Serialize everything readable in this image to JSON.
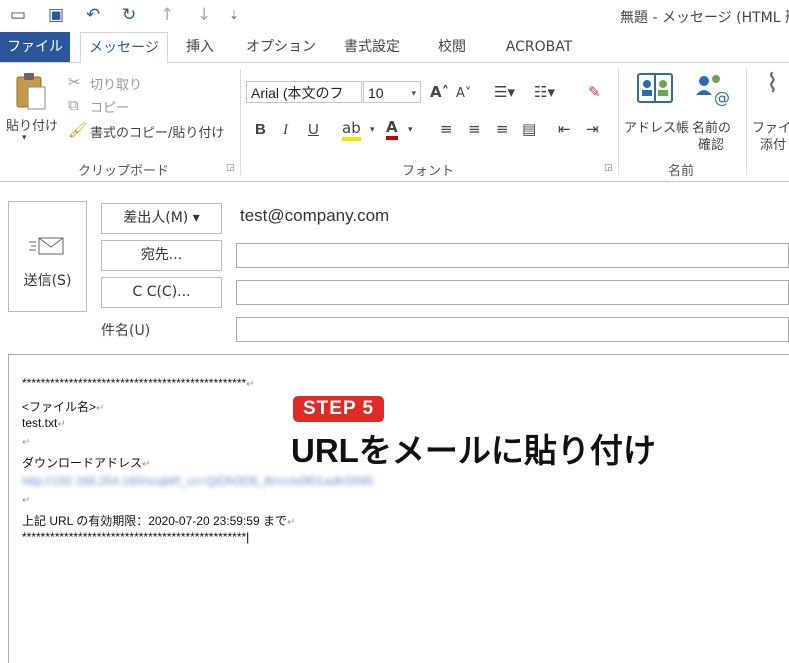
{
  "window": {
    "title": "無題 - メッセージ (HTML 形"
  },
  "quick_access": [
    "save-icon",
    "undo-icon",
    "redo-icon",
    "up-arrow-icon",
    "down-arrow-icon",
    "customize-icon"
  ],
  "tabs": [
    {
      "label": "ファイル",
      "kind": "file"
    },
    {
      "label": "メッセージ",
      "kind": "active"
    },
    {
      "label": "挿入"
    },
    {
      "label": "オプション"
    },
    {
      "label": "書式設定"
    },
    {
      "label": "校閲"
    },
    {
      "label": "ACROBAT"
    }
  ],
  "ribbon": {
    "clipboard": {
      "paste": "貼り付け",
      "cut": "切り取り",
      "copy": "コピー",
      "format_painter": "書式のコピー/貼り付け",
      "label": "クリップボード"
    },
    "font": {
      "font_name": "Arial (本文のフ",
      "font_size": "10",
      "label": "フォント",
      "bold": "B",
      "italic": "I",
      "underline": "U"
    },
    "names": {
      "address_book": "アドレス帳",
      "check_names_1": "名前の",
      "check_names_2": "確認",
      "label": "名前"
    },
    "include": {
      "attach_1": "ファイル",
      "attach_2": "添付"
    }
  },
  "header": {
    "send": "送信(S)",
    "from_button": "差出人(M) ▾",
    "from_value": "test@company.com",
    "to_button": "宛先...",
    "cc_button": "C C(C)...",
    "subject_label": "件名(U)"
  },
  "body": {
    "rule_top": "************************************************",
    "file_name_label": "<ファイル名>",
    "file_name": "test.txt",
    "download_label": "ダウンロードアドレス",
    "blurred_url": "http://192.168.254.160/scqbl/f_cn=QiDN3D6_8rrcclo0f01adfc5595",
    "expiry": "上記 URL の有効期限：2020-07-20 23:59:59  まで",
    "rule_bottom": "************************************************",
    "return_mark": "↵"
  },
  "overlay": {
    "step": "STEP 5",
    "caption": "URLをメールに貼り付け"
  },
  "colors": {
    "file_tab": "#2b579a",
    "step_badge": "#e02a27",
    "accent_red": "#c00000"
  }
}
